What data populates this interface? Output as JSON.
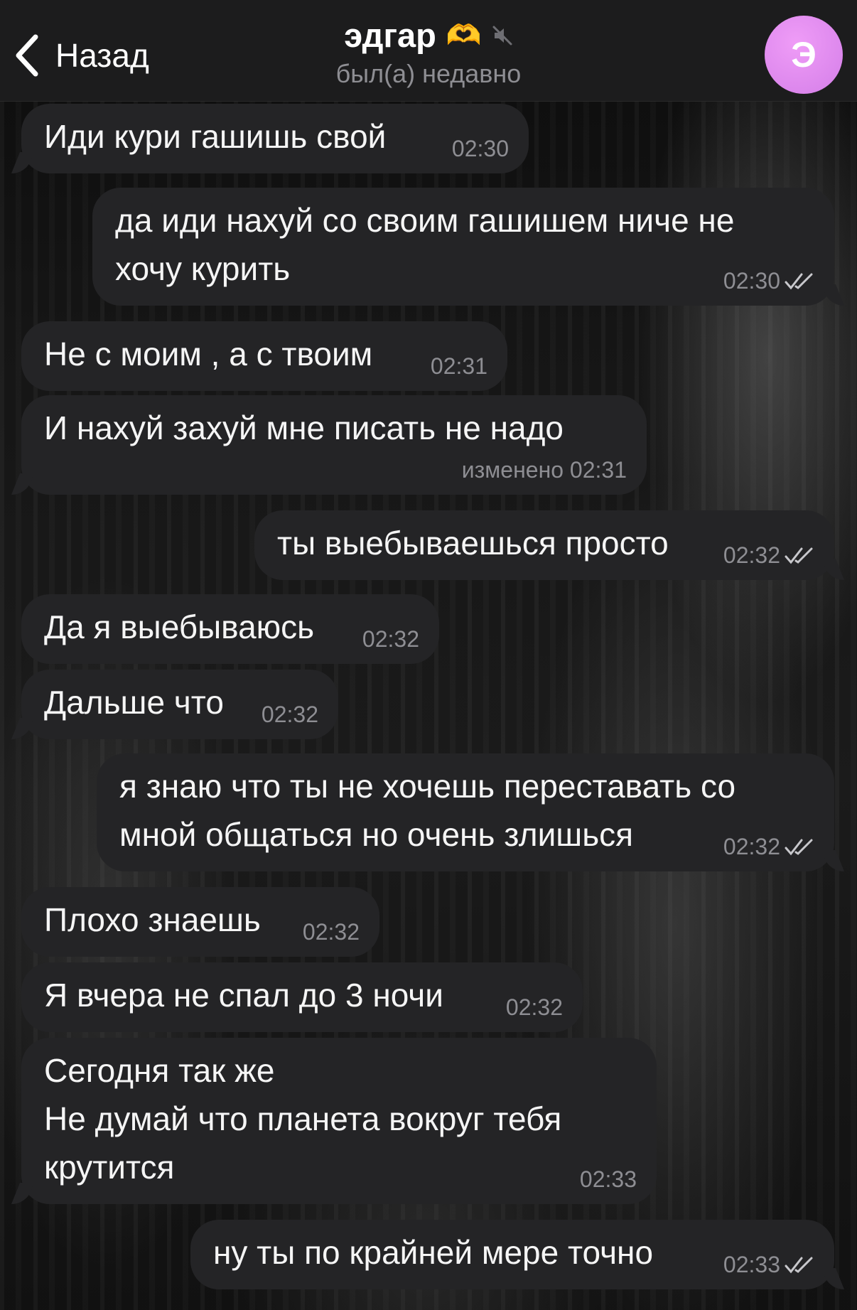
{
  "header": {
    "back_label": "Назад",
    "title": "эдгар",
    "title_emoji": "🫶",
    "subtitle": "был(а) недавно",
    "avatar_letter": "Э",
    "avatar_color": "#d47ee8"
  },
  "messages": [
    {
      "direction": "incoming",
      "text": "Иди кури гашишь свой",
      "time": "02:30"
    },
    {
      "direction": "outgoing",
      "text_lines": [
        "да иди нахуй со своим гашишем ниче не",
        "хочу курить"
      ],
      "time": "02:30",
      "read": true
    },
    {
      "direction": "incoming",
      "text": "Не с моим , а с твоим",
      "time": "02:31"
    },
    {
      "direction": "incoming",
      "text": "И нахуй захуй мне писать не надо",
      "edited_label": "изменено 02:31"
    },
    {
      "direction": "outgoing",
      "text": "ты выебываешься просто",
      "time": "02:32",
      "read": true
    },
    {
      "direction": "incoming",
      "text": "Да я выебываюсь",
      "time": "02:32"
    },
    {
      "direction": "incoming",
      "text": "Дальше что",
      "time": "02:32"
    },
    {
      "direction": "outgoing",
      "text_lines": [
        "я знаю что ты не хочешь переставать со",
        "мной общаться но очень злишься"
      ],
      "time": "02:32",
      "read": true
    },
    {
      "direction": "incoming",
      "text": "Плохо знаешь",
      "time": "02:32"
    },
    {
      "direction": "incoming",
      "text": "Я вчера не спал до 3 ночи",
      "time": "02:32"
    },
    {
      "direction": "incoming",
      "text_lines": [
        "Сегодня так же",
        "Не думай что планета вокруг тебя",
        "крутится"
      ],
      "time": "02:33"
    },
    {
      "direction": "outgoing",
      "text": "ну ты по крайней мере точно",
      "time": "02:33",
      "read": true
    }
  ]
}
